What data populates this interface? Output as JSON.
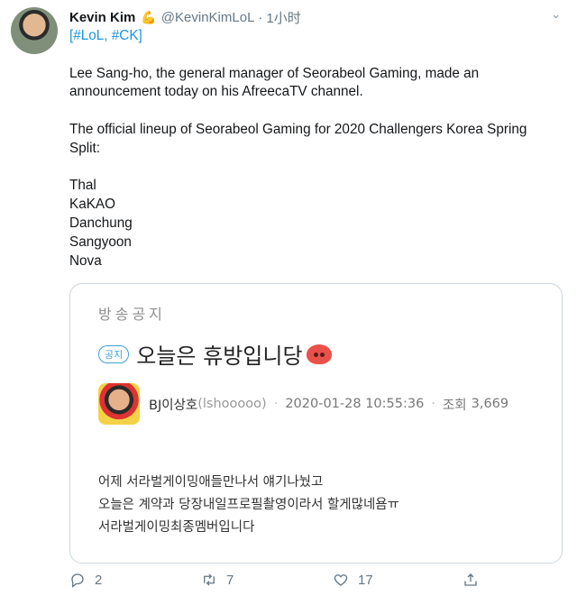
{
  "tweet": {
    "author_name": "Kevin Kim",
    "handle": "@KevinKimLoL",
    "time": "1小时",
    "badge_icon": "arm-flex-icon",
    "hashtags": [
      "#LoL",
      "#CK"
    ],
    "paragraph1": "Lee Sang-ho, the general manager of Seorabeol Gaming, made an announcement today on his AfreecaTV channel.",
    "paragraph2": "The official lineup of Seorabeol Gaming for 2020 Challengers Korea Spring Split:",
    "lineup": [
      "Thal",
      "KaKAO",
      "Danchung",
      "Sangyoon",
      "Nova"
    ]
  },
  "card": {
    "label": "방송공지",
    "tag": "공지",
    "title": "오늘은 휴방입니당",
    "author": "BJ이상호",
    "author_id": "(lshooooo)",
    "datetime": "2020-01-28 10:55:36",
    "views_label": "조회",
    "views": "3,669",
    "body_lines": [
      "어제 서라벌게이밍애들만나서 얘기나눴고",
      "오늘은 계약과 당장내일프로필촬영이라서 할게많네욤ㅠ",
      "서라벌게이밍최종멤버입니다"
    ]
  },
  "actions": {
    "replies": "2",
    "retweets": "7",
    "likes": "17"
  },
  "colors": {
    "link": "#1b95e0",
    "muted": "#657786",
    "notice": "#3fa2d6"
  }
}
